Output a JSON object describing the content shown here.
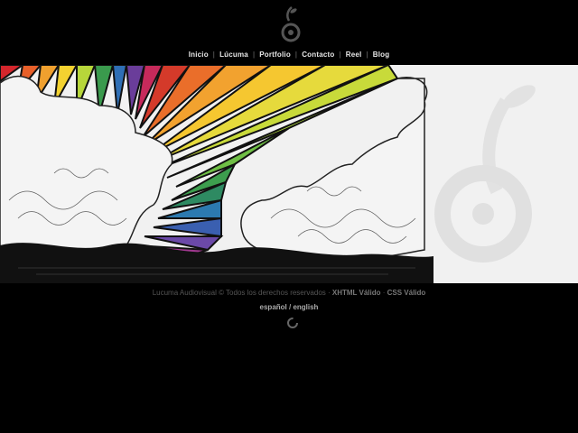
{
  "nav": {
    "items": [
      "Inicio",
      "Lúcuma",
      "Portfolio",
      "Contacto",
      "Reel",
      "Blog"
    ],
    "separator": "|"
  },
  "footer": {
    "copyright": "Lucuma Audiovisual © Todos los derechos reservados",
    "dot1": " · ",
    "xhtml": "XHTML Válido",
    "dot2": " · ",
    "css": "CSS Válido"
  },
  "lang": {
    "es": "español",
    "slash": " / ",
    "en": "english"
  },
  "icons": {
    "logo": "lucuma-seed-logo",
    "loader": "loading-spinner-icon"
  }
}
